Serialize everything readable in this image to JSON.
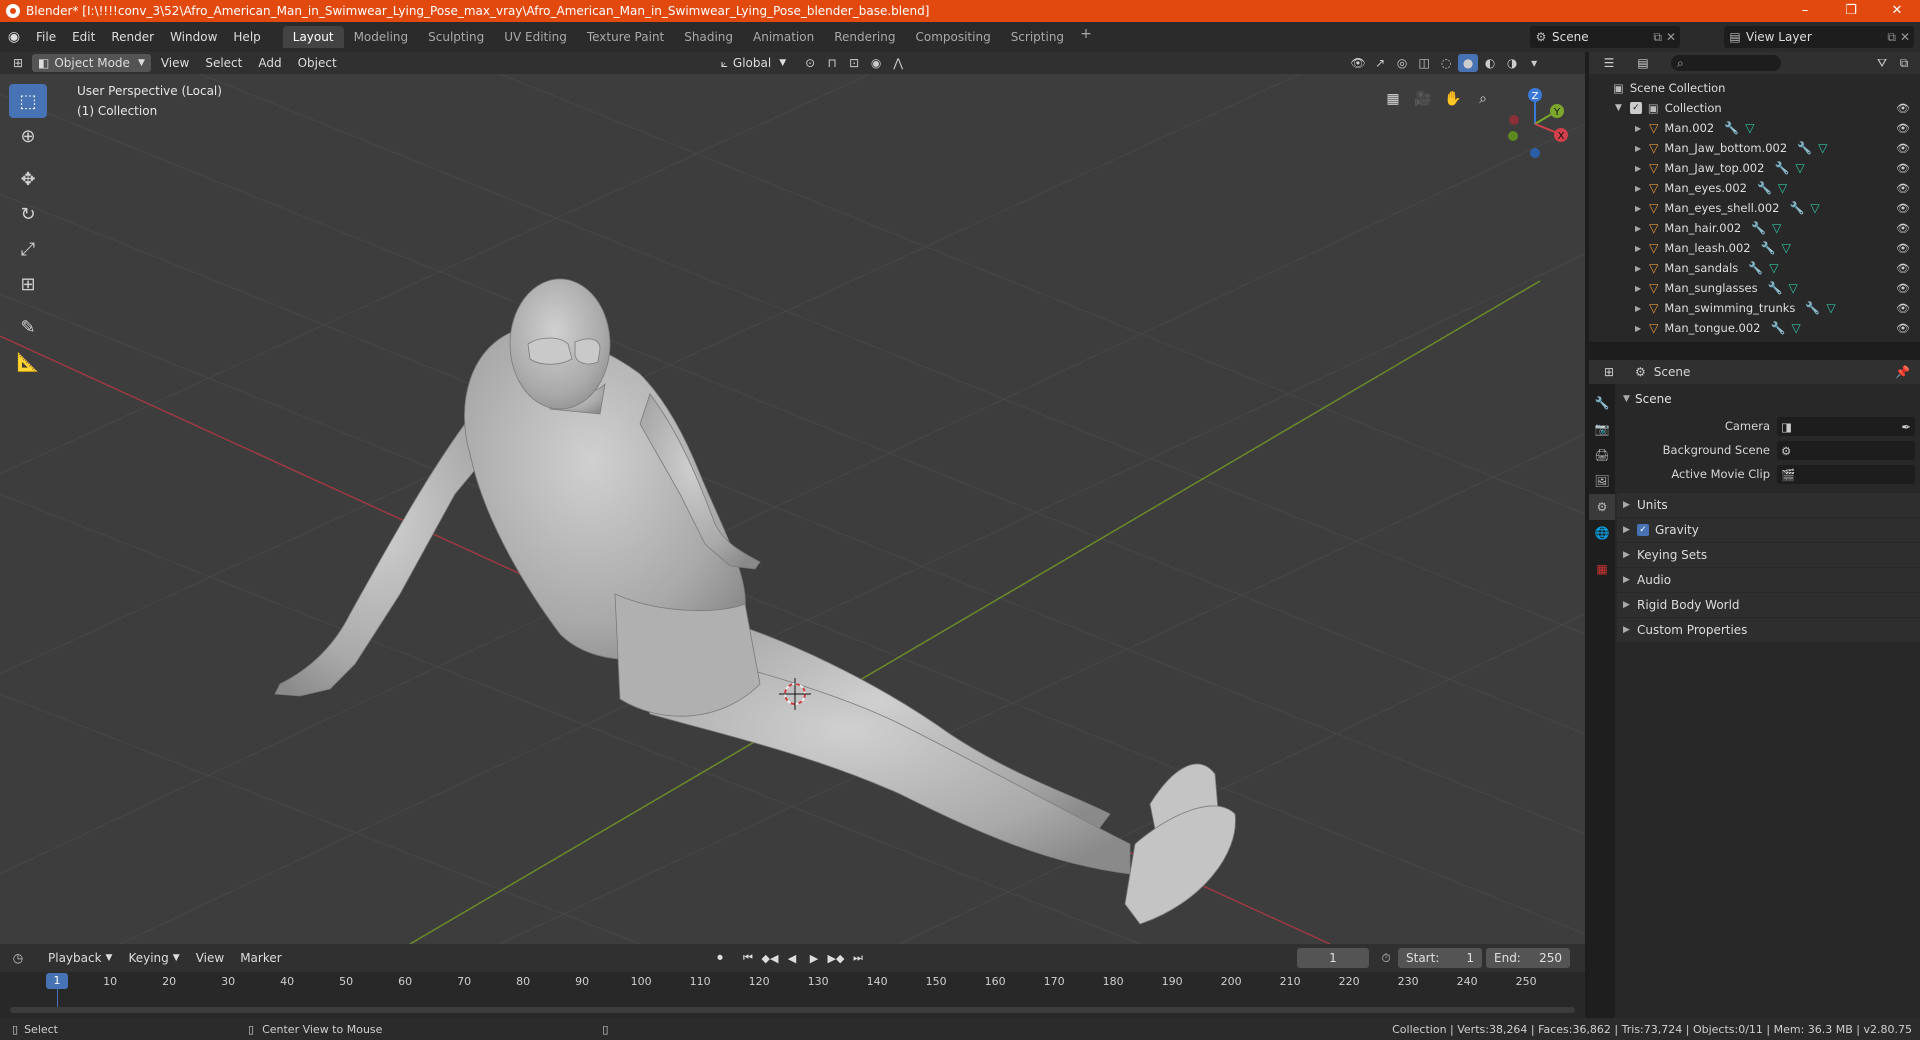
{
  "window": {
    "title": "Blender* [I:\\!!!!conv_3\\52\\Afro_American_Man_in_Swimwear_Lying_Pose_max_vray\\Afro_American_Man_in_Swimwear_Lying_Pose_blender_base.blend]",
    "controls": [
      "–",
      "❐",
      "✕"
    ]
  },
  "menu": [
    "File",
    "Edit",
    "Render",
    "Window",
    "Help"
  ],
  "workspaces": [
    "Layout",
    "Modeling",
    "Sculpting",
    "UV Editing",
    "Texture Paint",
    "Shading",
    "Animation",
    "Rendering",
    "Compositing",
    "Scripting"
  ],
  "active_workspace": "Layout",
  "scene_selector": {
    "value": "Scene"
  },
  "view_layer_selector": {
    "value": "View Layer"
  },
  "viewport_header": {
    "mode": "Object Mode",
    "menus": [
      "View",
      "Select",
      "Add",
      "Object"
    ],
    "transform_orientation": "Global"
  },
  "viewport": {
    "perspective_label": "User Perspective (Local)",
    "collection_label": "(1) Collection",
    "axis_labels": {
      "x": "X",
      "y": "Y",
      "z": "Z"
    },
    "colors": {
      "background": "#3d3d3d",
      "grid": "#4a4a4a",
      "x_axis": "#9c3a41",
      "y_axis": "#6c8a2a",
      "model": "#b8b8b8"
    }
  },
  "outliner": {
    "root": "Scene Collection",
    "collection": "Collection",
    "objects": [
      "Man.002",
      "Man_Jaw_bottom.002",
      "Man_Jaw_top.002",
      "Man_eyes.002",
      "Man_eyes_shell.002",
      "Man_hair.002",
      "Man_leash.002",
      "Man_sandals",
      "Man_sunglasses",
      "Man_swimming_trunks",
      "Man_tongue.002"
    ]
  },
  "properties": {
    "context": "Scene",
    "panel": "Scene",
    "fields": [
      {
        "label": "Camera",
        "value": ""
      },
      {
        "label": "Background Scene",
        "value": ""
      },
      {
        "label": "Active Movie Clip",
        "value": ""
      }
    ],
    "subpanels": [
      "Units",
      "Gravity",
      "Keying Sets",
      "Audio",
      "Rigid Body World",
      "Custom Properties"
    ],
    "gravity_checked": true
  },
  "timeline": {
    "menus": [
      "Playback",
      "Keying",
      "View",
      "Marker"
    ],
    "current_frame": "1",
    "start_label": "Start:",
    "start": "1",
    "end_label": "End:",
    "end": "250",
    "ruler": [
      "10",
      "20",
      "30",
      "40",
      "50",
      "60",
      "70",
      "80",
      "90",
      "100",
      "110",
      "120",
      "130",
      "140",
      "150",
      "160",
      "170",
      "180",
      "190",
      "200",
      "210",
      "220",
      "230",
      "240",
      "250"
    ],
    "ruler_current": "1"
  },
  "statusbar": {
    "left": "Select",
    "middle": "Center View to Mouse",
    "right": "Collection | Verts:38,264 | Faces:36,862 | Tris:73,724 | Objects:0/11 | Mem: 36.3 MB | v2.80.75"
  }
}
